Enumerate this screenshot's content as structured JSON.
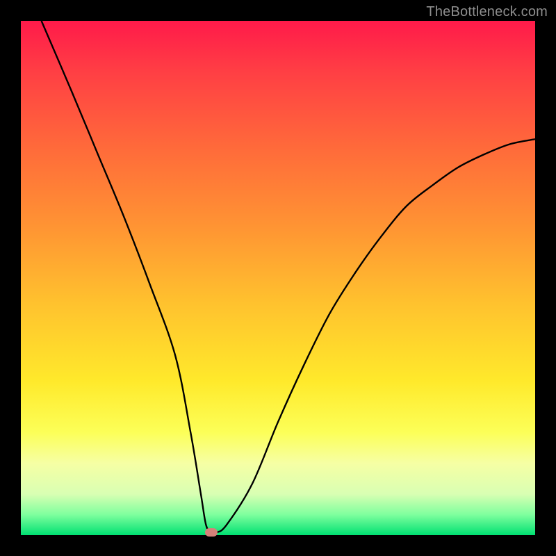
{
  "watermark": "TheBottleneck.com",
  "chart_data": {
    "type": "line",
    "title": "",
    "xlabel": "",
    "ylabel": "",
    "xlim": [
      0,
      100
    ],
    "ylim": [
      0,
      100
    ],
    "grid": false,
    "legend": false,
    "series": [
      {
        "name": "bottleneck-curve",
        "x": [
          4,
          10,
          15,
          20,
          25,
          30,
          33,
          35,
          36,
          37,
          38,
          40,
          45,
          50,
          55,
          60,
          65,
          70,
          75,
          80,
          85,
          90,
          95,
          100
        ],
        "y": [
          100,
          86,
          74,
          62,
          49,
          35,
          20,
          8,
          2,
          0.5,
          0.5,
          2,
          10,
          22,
          33,
          43,
          51,
          58,
          64,
          68,
          71.5,
          74,
          76,
          77
        ]
      }
    ],
    "optimum_marker": {
      "x": 37,
      "y": 0.5
    },
    "background_gradient": {
      "top": "#ff1a4a",
      "mid": "#ffe92b",
      "bottom": "#00e072"
    }
  }
}
